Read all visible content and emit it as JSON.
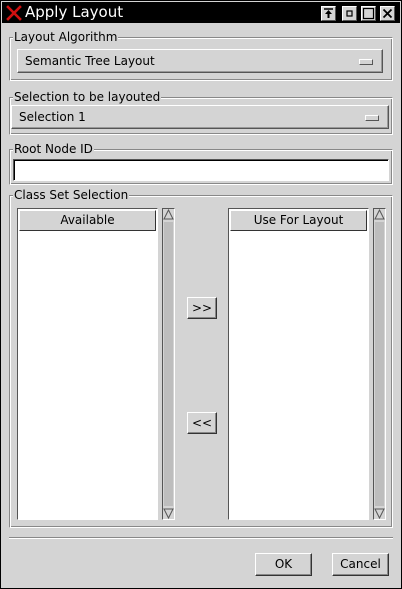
{
  "window": {
    "title": "Apply Layout"
  },
  "layout_algorithm": {
    "label": "Layout Algorithm",
    "selected": "Semantic Tree Layout"
  },
  "selection": {
    "label": "Selection to be layouted",
    "selected": "Selection 1"
  },
  "root_node": {
    "label": "Root Node ID",
    "value": ""
  },
  "class_set": {
    "label": "Class Set Selection",
    "available_header": "Available",
    "use_header": "Use For Layout",
    "available_items": [],
    "use_items": [],
    "add_label": ">>",
    "remove_label": "<<"
  },
  "buttons": {
    "ok": "OK",
    "cancel": "Cancel"
  }
}
